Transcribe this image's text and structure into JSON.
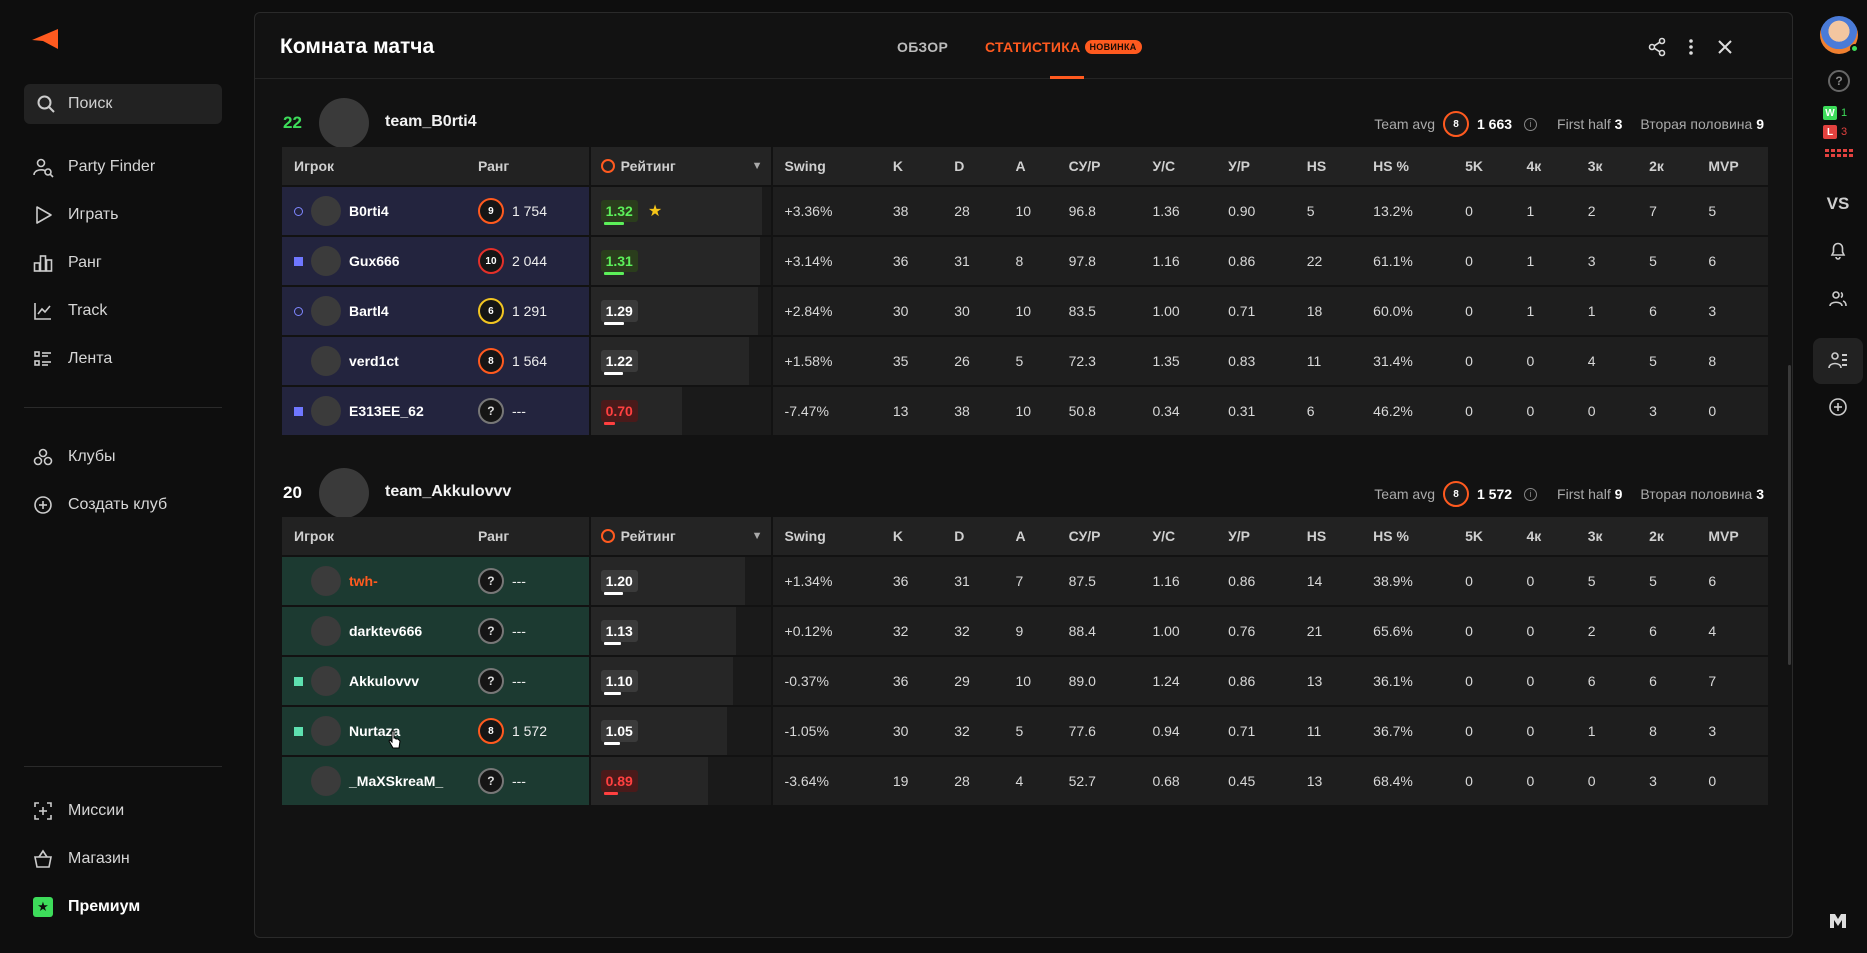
{
  "sidebar": {
    "search_label": "Поиск",
    "nav": [
      {
        "label": "Party Finder",
        "icon": "party-finder-icon"
      },
      {
        "label": "Играть",
        "icon": "play-icon"
      },
      {
        "label": "Ранг",
        "icon": "rank-chart-icon"
      },
      {
        "label": "Track",
        "icon": "track-icon"
      },
      {
        "label": "Лента",
        "icon": "feed-icon"
      }
    ],
    "clubs": [
      {
        "label": "Клубы",
        "icon": "clubs-icon"
      },
      {
        "label": "Создать клуб",
        "icon": "add-club-icon"
      }
    ],
    "bottom": [
      {
        "label": "Миссии",
        "icon": "missions-icon"
      },
      {
        "label": "Магазин",
        "icon": "shop-icon"
      },
      {
        "label": "Премиум",
        "icon": "premium-icon"
      }
    ]
  },
  "rail": {
    "wins": "1",
    "losses": "3",
    "vs_label": "VS",
    "help_label": "?",
    "win_badge": "W",
    "loss_badge": "L"
  },
  "modal": {
    "title": "Комната матча",
    "tab_overview": "ОБЗОР",
    "tab_stats": "СТАТИСТИКА",
    "tab_badge": "НОВИНКА"
  },
  "columns": [
    "Игрок",
    "Ранг",
    "Рейтинг",
    "Swing",
    "K",
    "D",
    "A",
    "СУ/Р",
    "У/С",
    "У/Р",
    "HS",
    "HS %",
    "5K",
    "4к",
    "3к",
    "2к",
    "MVP"
  ],
  "team_avg_label": "Team avg",
  "first_half_label": "First half",
  "second_half_label": "Вторая половина",
  "teams": [
    {
      "score": "22",
      "score_color": "#3ddc5a",
      "name": "team_B0rti4",
      "avg_level": "8",
      "avg_elo": "1 663",
      "first_half": "3",
      "second_half": "9",
      "theme": "blue",
      "players": [
        {
          "name": "B0rti4",
          "mark": "ring",
          "level": "9",
          "level_color": "orange",
          "elo": "1 754",
          "rating": "1.32",
          "rating_kind": "good",
          "rating_fill": 0.95,
          "star": true,
          "swing": "+3.36%",
          "k": "38",
          "d": "28",
          "a": "10",
          "adr": "96.8",
          "kd": "1.36",
          "kr": "0.90",
          "hs": "5",
          "hsp": "13.2%",
          "k5": "0",
          "k4": "1",
          "k3": "2",
          "k2": "7",
          "mvp": "5"
        },
        {
          "name": "Gux666",
          "mark": "sq",
          "level": "10",
          "level_color": "red",
          "elo": "2 044",
          "rating": "1.31",
          "rating_kind": "good",
          "rating_fill": 0.94,
          "star": false,
          "swing": "+3.14%",
          "k": "36",
          "d": "31",
          "a": "8",
          "adr": "97.8",
          "kd": "1.16",
          "kr": "0.86",
          "hs": "22",
          "hsp": "61.1%",
          "k5": "0",
          "k4": "1",
          "k3": "3",
          "k2": "5",
          "mvp": "6"
        },
        {
          "name": "Bartl4",
          "mark": "ring",
          "level": "6",
          "level_color": "yellow",
          "elo": "1 291",
          "rating": "1.29",
          "rating_kind": "normal",
          "rating_fill": 0.93,
          "star": false,
          "swing": "+2.84%",
          "k": "30",
          "d": "30",
          "a": "10",
          "adr": "83.5",
          "kd": "1.00",
          "kr": "0.71",
          "hs": "18",
          "hsp": "60.0%",
          "k5": "0",
          "k4": "1",
          "k3": "1",
          "k2": "6",
          "mvp": "3"
        },
        {
          "name": "verd1ct",
          "mark": "none",
          "level": "8",
          "level_color": "orange",
          "elo": "1 564",
          "rating": "1.22",
          "rating_kind": "normal",
          "rating_fill": 0.88,
          "star": false,
          "swing": "+1.58%",
          "k": "35",
          "d": "26",
          "a": "5",
          "adr": "72.3",
          "kd": "1.35",
          "kr": "0.83",
          "hs": "11",
          "hsp": "31.4%",
          "k5": "0",
          "k4": "0",
          "k3": "4",
          "k2": "5",
          "mvp": "8"
        },
        {
          "name": "E313EE_62",
          "mark": "sq",
          "level": "?",
          "level_color": "unknown",
          "elo": "---",
          "rating": "0.70",
          "rating_kind": "bad",
          "rating_fill": 0.51,
          "star": false,
          "swing": "-7.47%",
          "k": "13",
          "d": "38",
          "a": "10",
          "adr": "50.8",
          "kd": "0.34",
          "kr": "0.31",
          "hs": "6",
          "hsp": "46.2%",
          "k5": "0",
          "k4": "0",
          "k3": "0",
          "k2": "3",
          "mvp": "0"
        }
      ]
    },
    {
      "score": "20",
      "score_color": "#ffffff",
      "name": "team_Akkulovvv",
      "avg_level": "8",
      "avg_elo": "1 572",
      "first_half": "9",
      "second_half": "3",
      "theme": "green",
      "players": [
        {
          "name": "twh-",
          "mark": "none",
          "me": true,
          "level": "?",
          "level_color": "unknown",
          "elo": "---",
          "rating": "1.20",
          "rating_kind": "normal",
          "rating_fill": 0.86,
          "star": false,
          "swing": "+1.34%",
          "k": "36",
          "d": "31",
          "a": "7",
          "adr": "87.5",
          "kd": "1.16",
          "kr": "0.86",
          "hs": "14",
          "hsp": "38.9%",
          "k5": "0",
          "k4": "0",
          "k3": "5",
          "k2": "5",
          "mvp": "6"
        },
        {
          "name": "darktev666",
          "mark": "none",
          "level": "?",
          "level_color": "unknown",
          "elo": "---",
          "rating": "1.13",
          "rating_kind": "normal",
          "rating_fill": 0.81,
          "star": false,
          "swing": "+0.12%",
          "k": "32",
          "d": "32",
          "a": "9",
          "adr": "88.4",
          "kd": "1.00",
          "kr": "0.76",
          "hs": "21",
          "hsp": "65.6%",
          "k5": "0",
          "k4": "0",
          "k3": "2",
          "k2": "6",
          "mvp": "4"
        },
        {
          "name": "Akkulovvv",
          "mark": "sqg",
          "level": "?",
          "level_color": "unknown",
          "elo": "---",
          "rating": "1.10",
          "rating_kind": "normal",
          "rating_fill": 0.79,
          "star": false,
          "swing": "-0.37%",
          "k": "36",
          "d": "29",
          "a": "10",
          "adr": "89.0",
          "kd": "1.24",
          "kr": "0.86",
          "hs": "13",
          "hsp": "36.1%",
          "k5": "0",
          "k4": "0",
          "k3": "6",
          "k2": "6",
          "mvp": "7"
        },
        {
          "name": "Nurtaza",
          "mark": "sqg",
          "level": "8",
          "level_color": "orange",
          "elo": "1 572",
          "rating": "1.05",
          "rating_kind": "normal",
          "rating_fill": 0.76,
          "star": false,
          "swing": "-1.05%",
          "k": "30",
          "d": "32",
          "a": "5",
          "adr": "77.6",
          "kd": "0.94",
          "kr": "0.71",
          "hs": "11",
          "hsp": "36.7%",
          "k5": "0",
          "k4": "0",
          "k3": "1",
          "k2": "8",
          "mvp": "3"
        },
        {
          "name": "_MaXSkreaM_",
          "mark": "none",
          "level": "?",
          "level_color": "unknown",
          "elo": "---",
          "rating": "0.89",
          "rating_kind": "bad",
          "rating_fill": 0.65,
          "star": false,
          "swing": "-3.64%",
          "k": "19",
          "d": "28",
          "a": "4",
          "adr": "52.7",
          "kd": "0.68",
          "kr": "0.45",
          "hs": "13",
          "hsp": "68.4%",
          "k5": "0",
          "k4": "0",
          "k3": "0",
          "k2": "3",
          "mvp": "0"
        }
      ]
    }
  ],
  "colors": {
    "accent": "#ff5a1f",
    "win": "#3ddc5a",
    "loss": "#e2423f",
    "negative": "#ff4040"
  }
}
